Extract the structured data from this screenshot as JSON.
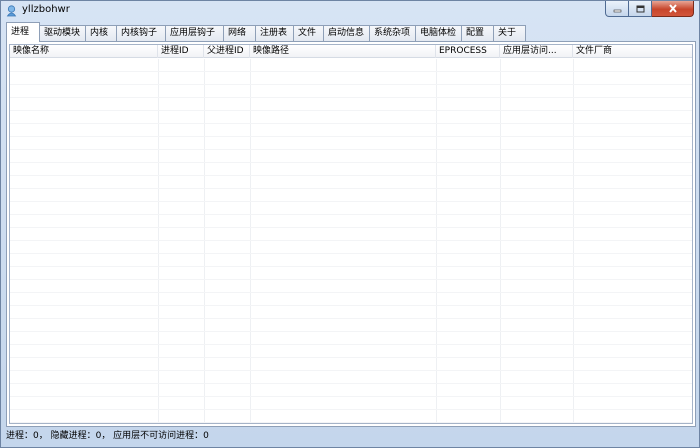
{
  "window": {
    "title": "yllzbohwr",
    "colors": {
      "frame": "#c9d9ec",
      "close_button": "#c7462c",
      "title_text": "#000000"
    }
  },
  "tabs": [
    {
      "label": "进程",
      "active": true
    },
    {
      "label": "驱动模块",
      "active": false
    },
    {
      "label": "内核",
      "active": false
    },
    {
      "label": "内核钩子",
      "active": false
    },
    {
      "label": "应用层钩子",
      "active": false
    },
    {
      "label": "网络",
      "active": false
    },
    {
      "label": "注册表",
      "active": false
    },
    {
      "label": "文件",
      "active": false
    },
    {
      "label": "启动信息",
      "active": false
    },
    {
      "label": "系统杂项",
      "active": false
    },
    {
      "label": "电脑体检",
      "active": false
    },
    {
      "label": "配置",
      "active": false
    },
    {
      "label": "关于",
      "active": false
    }
  ],
  "table": {
    "columns": [
      "映像名称",
      "进程ID",
      "父进程ID",
      "映像路径",
      "EPROCESS",
      "应用层访问...",
      "文件厂商"
    ],
    "rows": []
  },
  "status": {
    "text": "进程：0， 隐藏进程：0， 应用层不可访问进程：0"
  }
}
